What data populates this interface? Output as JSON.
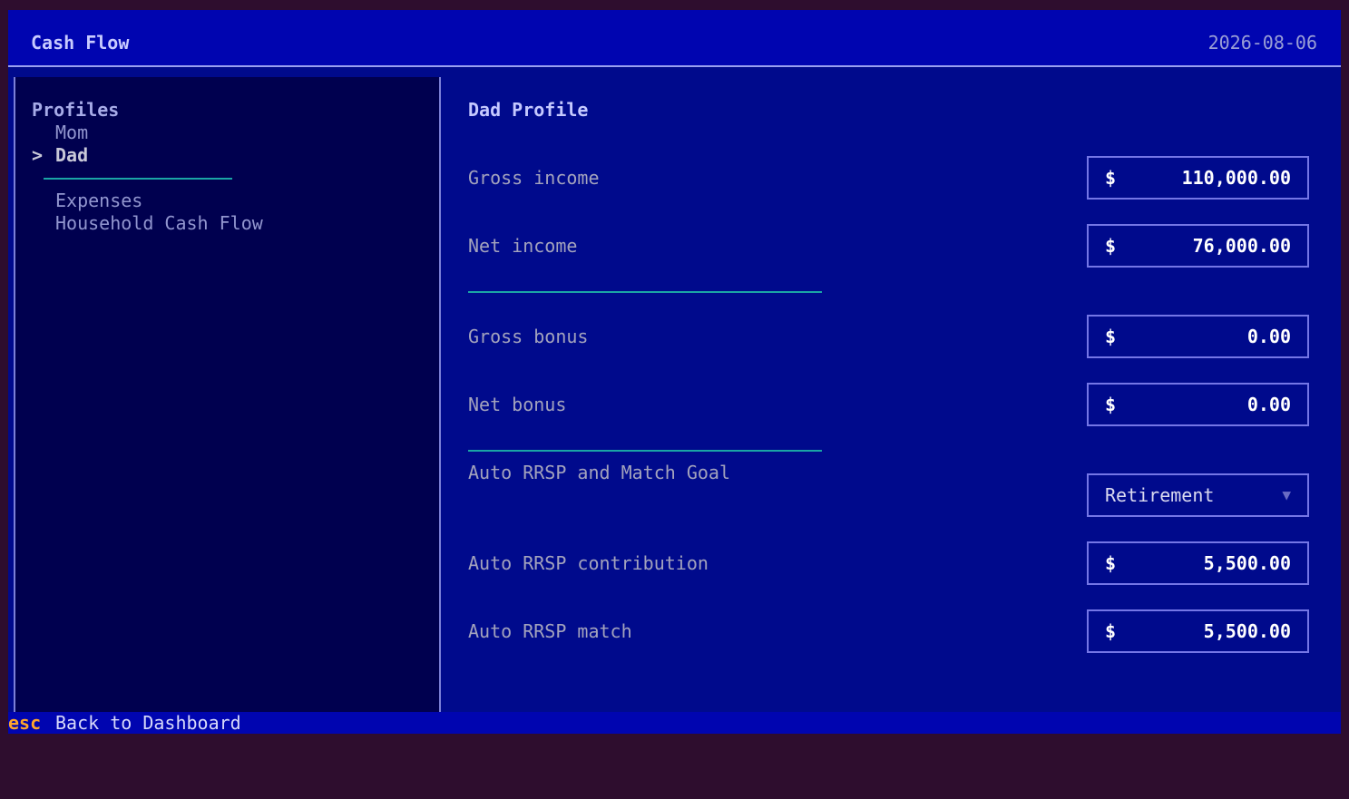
{
  "header": {
    "title": "Cash Flow",
    "date": "2026-08-06"
  },
  "sidebar": {
    "heading": "Profiles",
    "items": [
      {
        "label": "Mom"
      },
      {
        "label": "Dad",
        "marker": ">"
      },
      {
        "label": "Expenses"
      },
      {
        "label": "Household Cash Flow"
      }
    ]
  },
  "profile": {
    "title": "Dad Profile",
    "fields": [
      {
        "label": "Gross income",
        "currency": "$",
        "value": "110,000.00"
      },
      {
        "label": "Net income",
        "currency": "$",
        "value": "76,000.00"
      },
      {
        "label": "Gross bonus",
        "currency": "$",
        "value": "0.00"
      },
      {
        "label": "Net bonus",
        "currency": "$",
        "value": "0.00"
      },
      {
        "label": "Auto RRSP and Match Goal",
        "selected": "Retirement"
      },
      {
        "label": "Auto RRSP contribution",
        "currency": "$",
        "value": "5,500.00"
      },
      {
        "label": "Auto RRSP match",
        "currency": "$",
        "value": "5,500.00"
      }
    ]
  },
  "footer": {
    "key": "esc",
    "description": "Back to Dashboard"
  },
  "icons": {
    "dropdown": "chevron-down-icon"
  },
  "colors": {
    "separator": "#1aa5a5",
    "hotkey": "#ffa62b"
  }
}
